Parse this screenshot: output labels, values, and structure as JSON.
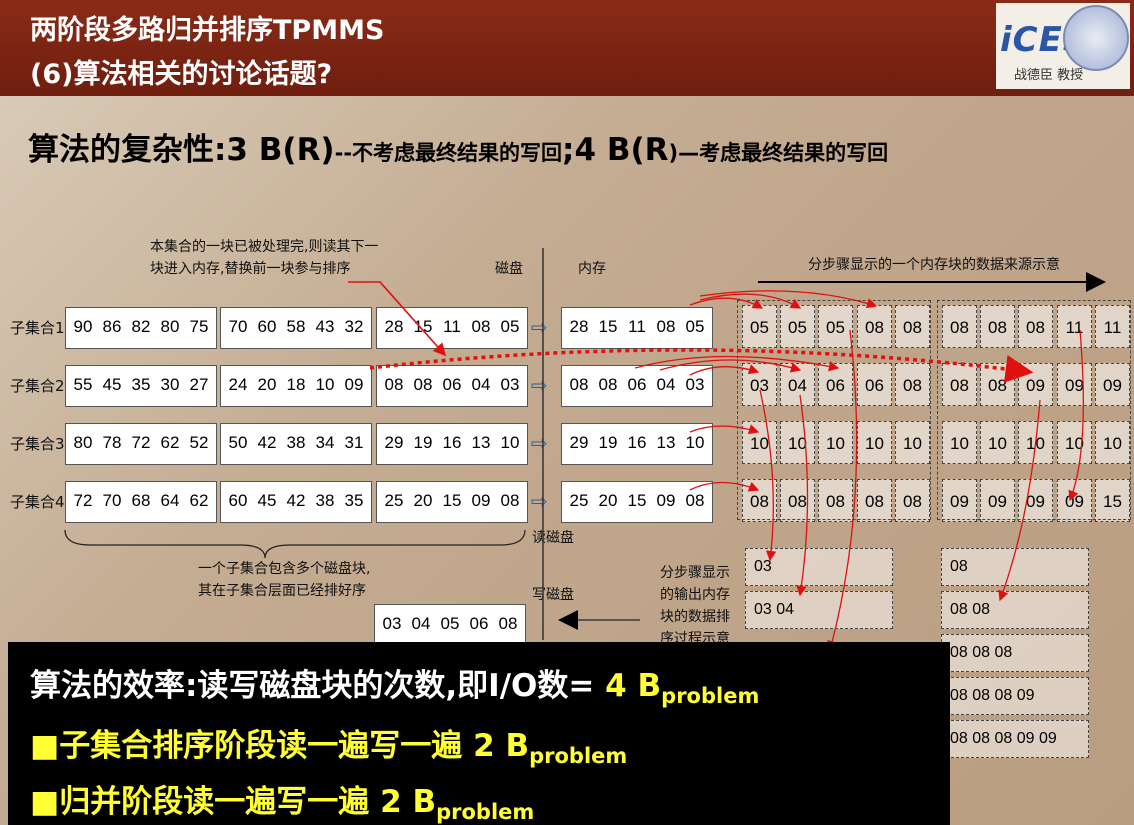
{
  "header": {
    "title_line1": "两阶段多路归并排序TPMMS",
    "title_line2": "(6)算法相关的讨论话题?",
    "logo_text": "iCES",
    "logo_caption": "战德臣 教授"
  },
  "complexity": {
    "label": "算法的复杂性:",
    "value1": "3 B(R)",
    "note1": "--不考虑最终结果的写回",
    "sep": ";",
    "value2": "4 B(R",
    "note2": ")—考虑最终结果的写回"
  },
  "diagram": {
    "annotation_top": [
      "本集合的一块已被处理完,则读其下一",
      "块进入内存,替换前一块参与排序"
    ],
    "label_disk": "磁盘",
    "label_memory": "内存",
    "label_steps": "分步骤显示的一个内存块的数据来源示意",
    "label_read_disk": "读磁盘",
    "label_write_disk": "写磁盘",
    "annotation_bottom": [
      "一个子集合包含多个磁盘块,",
      "其在子集合层面已经排好序"
    ],
    "annotation_output": [
      "分步骤显示",
      "的输出内存",
      "块的数据排",
      "序过程示意"
    ],
    "rows": [
      {
        "label": "子集合1",
        "blocks": [
          [
            "90",
            "86",
            "82",
            "80",
            "75"
          ],
          [
            "70",
            "60",
            "58",
            "43",
            "32"
          ],
          [
            "28",
            "15",
            "11",
            "08",
            "05"
          ]
        ],
        "mem": [
          "28",
          "15",
          "11",
          "08",
          "05"
        ]
      },
      {
        "label": "子集合2",
        "blocks": [
          [
            "55",
            "45",
            "35",
            "30",
            "27"
          ],
          [
            "24",
            "20",
            "18",
            "10",
            "09"
          ],
          [
            "08",
            "08",
            "06",
            "04",
            "03"
          ]
        ],
        "mem": [
          "08",
          "08",
          "06",
          "04",
          "03"
        ]
      },
      {
        "label": "子集合3",
        "blocks": [
          [
            "80",
            "78",
            "72",
            "62",
            "52"
          ],
          [
            "50",
            "42",
            "38",
            "34",
            "31"
          ],
          [
            "29",
            "19",
            "16",
            "13",
            "10"
          ]
        ],
        "mem": [
          "29",
          "19",
          "16",
          "13",
          "10"
        ]
      },
      {
        "label": "子集合4",
        "blocks": [
          [
            "72",
            "70",
            "68",
            "64",
            "62"
          ],
          [
            "60",
            "45",
            "42",
            "38",
            "35"
          ],
          [
            "25",
            "20",
            "15",
            "09",
            "08"
          ]
        ],
        "mem": [
          "25",
          "20",
          "15",
          "09",
          "08"
        ]
      }
    ],
    "steps_left": [
      [
        "05",
        "03",
        "10",
        "08"
      ],
      [
        "05",
        "04",
        "10",
        "08"
      ],
      [
        "05",
        "06",
        "10",
        "08"
      ],
      [
        "08",
        "06",
        "10",
        "08"
      ],
      [
        "08",
        "08",
        "10",
        "08"
      ]
    ],
    "steps_right": [
      [
        "08",
        "08",
        "10",
        "09"
      ],
      [
        "08",
        "08",
        "10",
        "09"
      ],
      [
        "08",
        "09",
        "10",
        "09"
      ],
      [
        "11",
        "09",
        "10",
        "09"
      ],
      [
        "11",
        "09",
        "10",
        "15"
      ]
    ],
    "output_left": [
      "03",
      "03  04"
    ],
    "output_right": [
      "08",
      "08  08",
      "08  08  08",
      "08  08  08  09",
      "08  08  08  09  09"
    ],
    "write_block": [
      "03",
      "04",
      "05",
      "06",
      "08"
    ]
  },
  "efficiency": {
    "line1_text": "算法的效率:读写磁盘块的次数,即I/O数=",
    "line1_value": "4 B",
    "line1_sub": "problem",
    "line2_text": "■子集合排序阶段读一遍写一遍",
    "line2_value": "2 B",
    "line2_sub": "problem",
    "line3_text": "■归并阶段读一遍写一遍",
    "line3_value": "2 B",
    "line3_sub": "problem"
  },
  "colors": {
    "header": "#7a2412",
    "highlight": "#ffff33",
    "arrow": "#e01010",
    "text_white": "#ffffff"
  }
}
